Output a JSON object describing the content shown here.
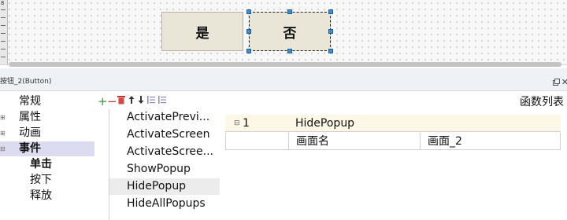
{
  "canvas": {
    "ruler_number": "8",
    "buttons": [
      {
        "label": "是"
      },
      {
        "label": "否",
        "selected": true
      }
    ],
    "handle_color": "#3b8fd8"
  },
  "panel": {
    "title": "按钮_2(Button)",
    "float_icon": "float-window-icon",
    "close_icon": "close-icon"
  },
  "tree": {
    "items": [
      {
        "label": "常规",
        "expander": ""
      },
      {
        "label": "属性",
        "expander": "⊞"
      },
      {
        "label": "动画",
        "expander": "⊞"
      },
      {
        "label": "事件",
        "expander": "⊟",
        "selected": true
      },
      {
        "label": "单击",
        "bold": true
      },
      {
        "label": "按下"
      },
      {
        "label": "释放"
      }
    ]
  },
  "toolbar": {
    "add": "+",
    "remove": "−",
    "delete": "🗑",
    "move_up": "⬆",
    "move_down": "⬇",
    "collapse": "☰",
    "expand": "☰",
    "functions_label": "函数列表"
  },
  "function_list": {
    "items": [
      {
        "label": "ActivatePrevi..."
      },
      {
        "label": "ActivateScreen"
      },
      {
        "label": "ActivateScree..."
      },
      {
        "label": "ShowPopup"
      },
      {
        "label": "HidePopup",
        "selected": true
      },
      {
        "label": "HideAllPopups"
      }
    ]
  },
  "function_table": {
    "row1": {
      "expander": "⊟",
      "index": "1",
      "name": "HidePopup"
    },
    "row2": {
      "param": "画面名",
      "value": "画面_2"
    }
  }
}
